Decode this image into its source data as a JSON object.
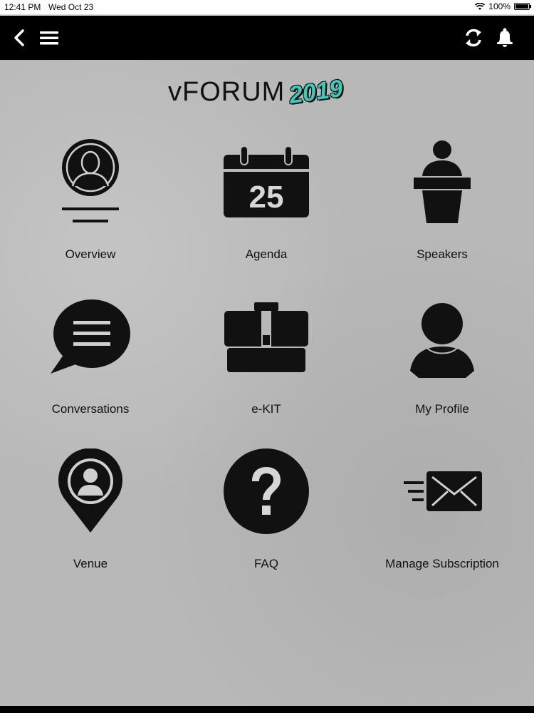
{
  "status_bar": {
    "time": "12:41 PM",
    "date": "Wed Oct 23",
    "battery": "100%"
  },
  "navbar": {
    "back_icon": "chevron-left-icon",
    "menu_icon": "hamburger-icon",
    "sync_icon": "sync-icon",
    "bell_icon": "bell-icon"
  },
  "logo": {
    "text": "vFORUM",
    "year": "2019",
    "year_color": "#3fc7b7"
  },
  "tiles": [
    {
      "label": "Overview",
      "icon": "overview-icon"
    },
    {
      "label": "Agenda",
      "icon": "calendar-icon",
      "day": "25"
    },
    {
      "label": "Speakers",
      "icon": "speaker-podium-icon"
    },
    {
      "label": "Conversations",
      "icon": "chat-bubble-icon"
    },
    {
      "label": "e-KIT",
      "icon": "briefcase-icon"
    },
    {
      "label": "My Profile",
      "icon": "profile-icon"
    },
    {
      "label": "Venue",
      "icon": "location-pin-icon"
    },
    {
      "label": "FAQ",
      "icon": "question-icon"
    },
    {
      "label": "Manage Subscription",
      "icon": "envelope-icon"
    }
  ]
}
